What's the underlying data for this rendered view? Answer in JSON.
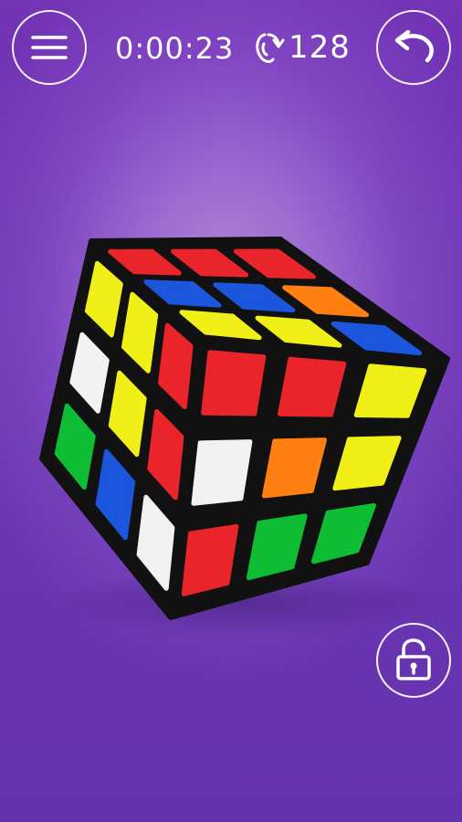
{
  "header": {
    "timer": "0:00:23",
    "move_count": "128"
  },
  "icons": {
    "menu": "hamburger-menu-icon",
    "moves": "rotate-moves-icon",
    "undo": "undo-arrow-icon",
    "lock": "unlocked-padlock-icon"
  },
  "cube": {
    "front_face": [
      [
        "yellow",
        "yellow",
        "red"
      ],
      [
        "white",
        "yellow",
        "red"
      ],
      [
        "green",
        "blue",
        "white"
      ]
    ],
    "top_face": [
      [
        "red",
        "red",
        "red"
      ],
      [
        "blue",
        "blue",
        "orange"
      ],
      [
        "yellow",
        "yellow",
        "blue"
      ]
    ],
    "right_face": [
      [
        "red",
        "red",
        "yellow"
      ],
      [
        "white",
        "orange",
        "yellow"
      ],
      [
        "red",
        "green",
        "green"
      ]
    ]
  },
  "colors": {
    "background_center": "#b58fd9",
    "background_edge": "#6e36b4",
    "red": "#e9242b",
    "orange": "#ff7f12",
    "yellow": "#f1ef18",
    "green": "#0fbd35",
    "blue": "#1b56dc",
    "white": "#f2f2f2",
    "cube_body": "#111111"
  }
}
